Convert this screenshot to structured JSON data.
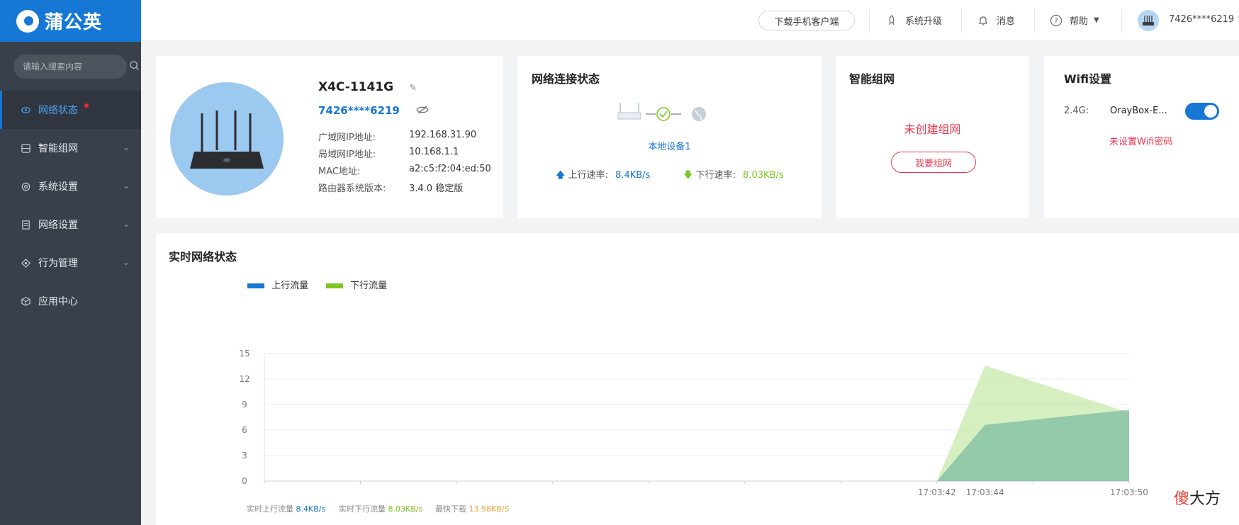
{
  "brand": {
    "name": "蒲公英"
  },
  "search": {
    "placeholder": "请输入搜索内容"
  },
  "sidebar": {
    "items": [
      {
        "label": "网络状态",
        "icon": "network-status-icon",
        "active": true
      },
      {
        "label": "智能组网",
        "icon": "smart-network-icon"
      },
      {
        "label": "系统设置",
        "icon": "settings-gear-icon"
      },
      {
        "label": "网络设置",
        "icon": "network-settings-icon"
      },
      {
        "label": "行为管理",
        "icon": "behavior-management-icon"
      },
      {
        "label": "应用中心",
        "icon": "app-center-icon"
      }
    ]
  },
  "header": {
    "download_label": "下载手机客户端",
    "upgrade_label": "系统升级",
    "messages_label": "消息",
    "help_label": "帮助",
    "user_label": "7426****6219"
  },
  "device": {
    "name": "X4C-1141G",
    "sn": "7426****6219",
    "wan_label": "广域网IP地址:",
    "wan_value": "192.168.31.90",
    "lan_label": "局域网IP地址:",
    "lan_value": "10.168.1.1",
    "mac_label": "MAC地址:",
    "mac_value": "a2:c5:f2:04:ed:50",
    "version_label": "路由器系统版本:",
    "version_value": "3.4.0 稳定版"
  },
  "connection": {
    "title": "网络连接状态",
    "device_label": "本地设备1",
    "up_label": "上行速率:",
    "up_value": "8.4KB/s",
    "down_label": "下行速率:",
    "down_value": "8.03KB/s"
  },
  "smart_network": {
    "title": "智能组网",
    "status": "未创建组网",
    "button": "我要组网"
  },
  "wifi": {
    "title": "Wifi设置",
    "band": "2.4G:",
    "ssid": "OrayBox-E...",
    "enabled": true,
    "warning": "未设置Wifi密码"
  },
  "realtime": {
    "title": "实时网络状态",
    "stat_up_label": "实时上行流量",
    "stat_up_value": "8.4KB/s",
    "stat_down_label": "实时下行流量",
    "stat_down_value": "8.03KB/s",
    "stat_max_label": "最快下载",
    "stat_max_value": "13.58KB/S"
  },
  "colors": {
    "accent": "#1677d4",
    "up_series": "#1677d4",
    "down_series": "#7cc623",
    "warn": "#e8374e",
    "max_stat": "#f2a33a"
  },
  "chart_data": {
    "type": "area",
    "title": "",
    "xlabel": "",
    "ylabel": "",
    "ylim": [
      0,
      15
    ],
    "yticks": [
      0,
      3,
      6,
      9,
      12,
      15
    ],
    "x": [
      "17:03:42",
      "17:03:44",
      "17:03:50"
    ],
    "legend_position": "top-left",
    "grid": true,
    "series": [
      {
        "name": "上行流量",
        "color": "#1677d4",
        "values": [
          0,
          6.6,
          8.4
        ]
      },
      {
        "name": "下行流量",
        "color": "#7cc623",
        "values": [
          0,
          13.6,
          8.03
        ]
      }
    ]
  },
  "watermark": {
    "text_a": "傻",
    "text_b": "大方"
  }
}
